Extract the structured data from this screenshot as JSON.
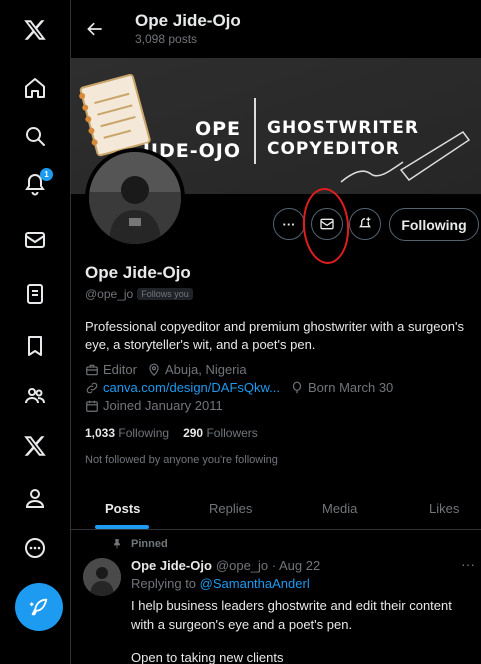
{
  "header": {
    "name": "Ope Jide-Ojo",
    "posts_count": "3,098 posts"
  },
  "banner": {
    "name_line1": "OPE",
    "name_line2": "JIDE-OJO",
    "role_line1": "GHOSTWRITER",
    "role_line2": "COPYEDITOR"
  },
  "actions": {
    "more_label": "···",
    "following_label": "Following"
  },
  "profile": {
    "name": "Ope Jide-Ojo",
    "handle": "@ope_jo",
    "follows_you": "Follows you",
    "bio": "Professional copyeditor and premium ghostwriter with a surgeon's eye, a storyteller's wit, and a poet's pen.",
    "profession": "Editor",
    "location": "Abuja, Nigeria",
    "website": "canva.com/design/DAFsQkw...",
    "birthday": "Born March 30",
    "joined": "Joined January 2011",
    "following_count": "1,033",
    "following_label": "Following",
    "followers_count": "290",
    "followers_label": "Followers",
    "not_followed": "Not followed by anyone you're following"
  },
  "nav": {
    "notification_count": "1"
  },
  "tabs": [
    {
      "label": "Posts"
    },
    {
      "label": "Replies"
    },
    {
      "label": "Media"
    },
    {
      "label": "Likes"
    }
  ],
  "pinned_post": {
    "pinned_label": "Pinned",
    "author": "Ope Jide-Ojo",
    "meta": "@ope_jo · Aug 22",
    "replying_prefix": "Replying to",
    "replying_to": "@SamanthaAnderl",
    "text": "I help business leaders ghostwrite and edit their content with a surgeon's eye and a poet's pen.",
    "text2": "Open to taking new clients",
    "more": "···"
  },
  "colors": {
    "accent": "#1d9bf0",
    "annotation": "#e01e1e"
  }
}
